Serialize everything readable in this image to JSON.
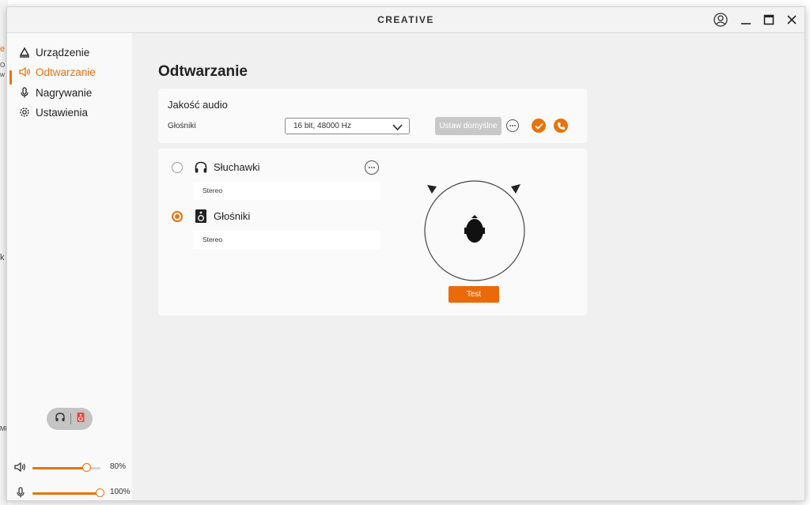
{
  "app": {
    "brand": "CREATIVE"
  },
  "background": {
    "fragments": [
      "e",
      "O",
      "w",
      "k",
      "MB"
    ]
  },
  "sidebar": {
    "items": [
      {
        "label": "Urządzenie",
        "icon": "device-triangle-icon",
        "active": false
      },
      {
        "label": "Odtwarzanie",
        "icon": "speaker-icon",
        "active": true
      },
      {
        "label": "Nagrywanie",
        "icon": "microphone-icon",
        "active": false
      },
      {
        "label": "Ustawienia",
        "icon": "gear-icon",
        "active": false
      }
    ],
    "volume": {
      "speaker_label": "80%",
      "speaker_value": 80,
      "mic_label": "100%",
      "mic_value": 100
    }
  },
  "main": {
    "title": "Odtwarzanie",
    "quality": {
      "title": "Jakość audio",
      "device_label": "Głośniki",
      "format_value": "16 bit, 48000 Hz",
      "default_button": "Ustaw domyślne"
    },
    "outputs": [
      {
        "name": "Słuchawki",
        "mode": "Stereo",
        "selected": false,
        "icon": "headphones-icon"
      },
      {
        "name": "Głośniki",
        "mode": "Stereo",
        "selected": true,
        "icon": "speaker-box-icon"
      }
    ],
    "test_button": "Test"
  },
  "colors": {
    "accent": "#e8730c",
    "window_bg": "#f0f0f0",
    "card_bg": "#fafafa"
  }
}
